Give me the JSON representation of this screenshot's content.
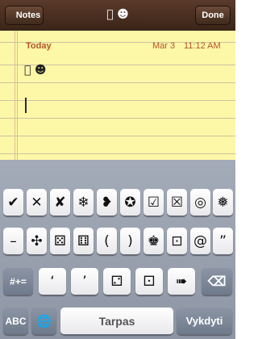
{
  "navbar": {
    "back_label": "Notes",
    "title": " ☻",
    "done_label": "Done"
  },
  "note": {
    "day_label": "Today",
    "date": "Mar 3",
    "time": "11:12 AM",
    "text": " ☻"
  },
  "keyboard": {
    "row1": [
      "✔",
      "✕",
      "✘",
      "❄",
      "❥",
      "✪",
      "☑",
      "☒",
      "◎",
      "❅"
    ],
    "row2": [
      "–",
      "✣",
      "⚄",
      "⚅",
      "(",
      ")",
      "♚",
      "⊡",
      "@",
      "”"
    ],
    "row3": [
      "#+=",
      "‘",
      "’",
      "⚁",
      "⚀",
      "➠",
      "⌫"
    ],
    "row4": [
      "ABC",
      "🌐",
      "Tarpas",
      "Vykdyti"
    ]
  },
  "colors": {
    "accent_text": "#b2562a",
    "paper": "#fdf7a8",
    "navbar": "#3a2418"
  }
}
